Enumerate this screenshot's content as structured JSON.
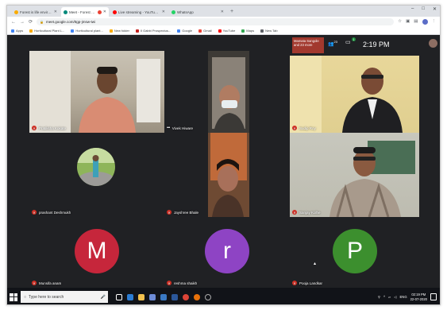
{
  "browser": {
    "tabs": [
      {
        "label": "Forest is life environment - Goo",
        "color": "#f9ab00",
        "active": false
      },
      {
        "label": "Meet - Forest Conservation",
        "color": "#00897b",
        "active": true
      },
      {
        "label": "Live streaming - YouTube Studio",
        "color": "#ff0000",
        "active": false
      },
      {
        "label": "WhatsApp",
        "color": "#25d366",
        "active": false
      }
    ],
    "url": "meet.google.com/ttgp-jmsw-twi",
    "bookmarks": [
      {
        "label": "Apps",
        "color": "#4285f4"
      },
      {
        "label": "Horticultural Plant L...",
        "color": "#f9ab00"
      },
      {
        "label": "Horticultural plant...",
        "color": "#4285f4"
      },
      {
        "label": "New folder",
        "color": "#f9ab00"
      },
      {
        "label": "Il Gabbi Prospectus...",
        "color": "#c5221f"
      },
      {
        "label": "Google",
        "color": "#4285f4"
      },
      {
        "label": "Gmail",
        "color": "#ea4335"
      },
      {
        "label": "YouTube",
        "color": "#ff0000"
      },
      {
        "label": "Maps",
        "color": "#34a853"
      },
      {
        "label": "New Tab",
        "color": "#5f6368"
      }
    ]
  },
  "meet": {
    "presenting": "Mamata Sangole and 23 more",
    "people_count": "23",
    "chat_badge": "1",
    "time": "2:19 PM",
    "participants": [
      {
        "name": "Pratiksha Kokate",
        "muted": true
      },
      {
        "name": "Vivek Hiware",
        "muted": false
      },
      {
        "name": "Sudip Roy",
        "muted": true
      },
      {
        "name": "prashant Deshmukh",
        "muted": true
      },
      {
        "name": "Jayshree Bhale",
        "muted": true
      },
      {
        "name": "Sanjay Kolhe",
        "muted": true
      },
      {
        "name": "Munsifa anam",
        "initial": "M",
        "color": "#c6263b",
        "muted": true
      },
      {
        "name": "reshma shaikh",
        "initial": "r",
        "color": "#8e44c4",
        "muted": true
      },
      {
        "name": "Pooja Landkar",
        "initial": "P",
        "color": "#3c8f2e",
        "muted": true
      }
    ]
  },
  "taskbar": {
    "search_placeholder": "Type here to search",
    "language": "ENG",
    "time": "02:19 PM",
    "date": "22-07-2020"
  },
  "icons": [
    "back-icon",
    "forward-icon",
    "reload-icon",
    "lock-icon",
    "star-icon",
    "people-icon",
    "chat-icon",
    "mic-off-icon",
    "more-icon",
    "windows-icon",
    "search-icon",
    "mic-icon",
    "notification-icon"
  ]
}
